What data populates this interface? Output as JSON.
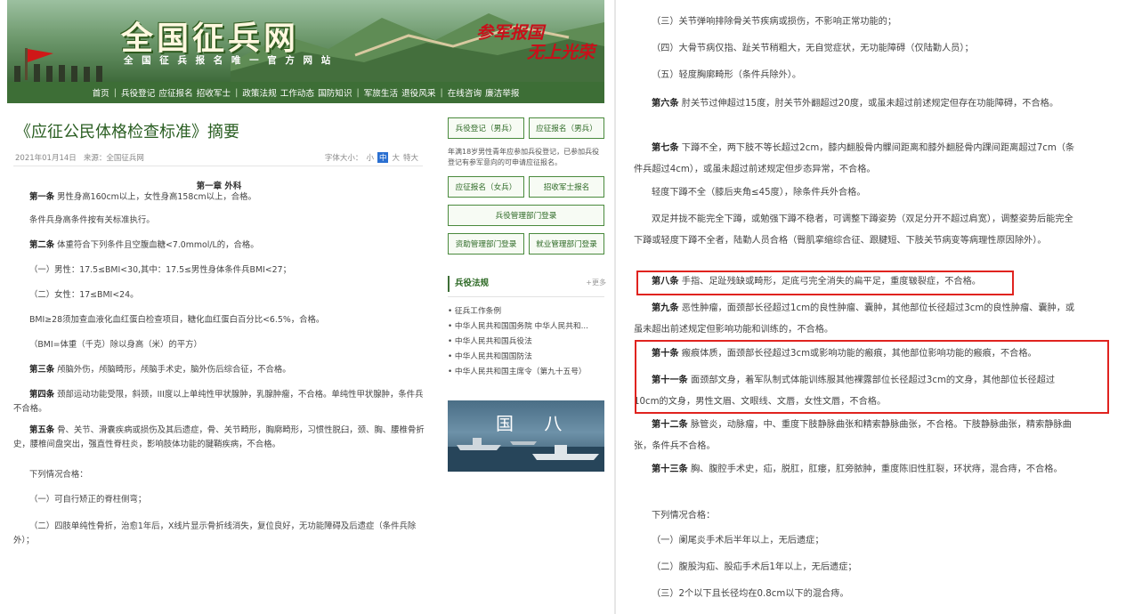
{
  "site": {
    "logo": "全国征兵网",
    "slogan": "全 国 征 兵 报 名 唯 一 官 方 网 站",
    "slogan_main": "参军报国",
    "slogan_sub": "无上光荣"
  },
  "nav": [
    "首页",
    "兵役登记",
    "应征报名",
    "招收军士",
    "政策法规",
    "工作动态",
    "国防知识",
    "军旅生活",
    "退役风采",
    "在线咨询",
    "廉洁举报"
  ],
  "article": {
    "title": "《应征公民体格检查标准》摘要",
    "date": "2021年01月14日",
    "source": "来源：全国征兵网",
    "font_label": "字体大小：",
    "font_small": "小",
    "font_mid": "中",
    "font_large": "大",
    "font_xlarge": "特大",
    "chapter": "第一章 外科",
    "paragraphs": [
      {
        "lead": "第一条",
        "text": " 男性身高160cm以上，女性身高158cm以上，合格。"
      },
      {
        "lead": "",
        "text": "条件兵身高条件按有关标准执行。"
      },
      {
        "lead": "第二条",
        "text": " 体重符合下列条件且空腹血糖<7.0mmol/L的，合格。"
      },
      {
        "lead": "",
        "text": "（一）男性：17.5≤BMI<30,其中：17.5≤男性身体条件兵BMI<27；"
      },
      {
        "lead": "",
        "text": "（二）女性：17≤BMI<24。"
      },
      {
        "lead": "",
        "text": "BMI≥28须加查血液化血红蛋白检查项目，糖化血红蛋白百分比<6.5%，合格。"
      },
      {
        "lead": "",
        "text": "（BMI=体重（千克）除以身高（米）的平方）"
      },
      {
        "lead": "第三条",
        "text": " 颅脑外伤，颅脑畸形，颅脑手术史，脑外伤后综合征，不合格。"
      },
      {
        "lead": "第四条",
        "text": " 颈部运动功能受限，斜颈，III度以上单纯性甲状腺肿，乳腺肿瘤，不合格。单纯性甲状腺肿，条件兵不合格。"
      },
      {
        "lead": "第五条",
        "text": " 骨、关节、滑囊疾病或损伤及其后遗症，骨、关节畸形，胸廓畸形，习惯性脱臼，颈、胸、腰椎骨折史，腰椎间盘突出，强直性脊柱炎，影响肢体功能的腱鞘疾病，不合格。"
      },
      {
        "lead": "",
        "text": "下列情况合格："
      },
      {
        "lead": "",
        "text": "（一）可自行矫正的脊柱侧弯；"
      },
      {
        "lead": "",
        "text": "（二）四肢单纯性骨折，治愈1年后，X线片显示骨折线消失，复位良好，无功能障碍及后遗症（条件兵除外）；"
      }
    ]
  },
  "sidebar": {
    "buttons": [
      "兵役登记（男兵）",
      "应征报名（男兵）",
      "应征报名（女兵）",
      "招收军士报名",
      "兵役管理部门登录",
      "资助管理部门登录",
      "就业管理部门登录"
    ],
    "note": "年满18岁男性青年应参加兵役登记，已参加兵役登记有参军意向的可申请应征报名。",
    "law_title": "兵役法规",
    "law_more": "+更多",
    "laws": [
      "• 征兵工作条例",
      "• 中华人民共和国国务院 中华人民共和...",
      "• 中华人民共和国兵役法",
      "• 中华人民共和国国防法",
      "• 中华人民共和国主席令（第九十五号）"
    ],
    "image_text": "国 八"
  },
  "right": {
    "paragraphs": [
      {
        "lead": "",
        "text": "（三）关节弹响排除骨关节疾病或损伤，不影响正常功能的；"
      },
      {
        "lead": "",
        "text": "（四）大骨节病仅指、趾关节稍粗大，无自觉症状，无功能障碍（仅陆勤人员）；"
      },
      {
        "lead": "",
        "text": "（五）轻度胸廓畸形（条件兵除外）。"
      },
      {
        "lead": "第六条",
        "text": " 肘关节过伸超过15度，肘关节外翻超过20度，或虽未超过前述规定但存在功能障碍，不合格。"
      },
      {
        "lead": "第七条",
        "text": " 下蹲不全，两下肢不等长超过2cm，膝内翻股骨内髁间距离和膝外翻胫骨内踝间距离超过7cm（条件兵超过4cm），或虽未超过前述规定但步态异常，不合格。"
      },
      {
        "lead": "",
        "text": "轻度下蹲不全（膝后夹角≤45度），除条件兵外合格。"
      },
      {
        "lead": "",
        "text": "双足并拢不能完全下蹲，或勉强下蹲不稳者，可调整下蹲姿势（双足分开不超过肩宽），调整姿势后能完全下蹲或轻度下蹲不全者，陆勤人员合格（臀肌挛缩综合征、跟腱短、下肢关节病变等病理性原因除外）。"
      },
      {
        "lead": "第八条",
        "text": " 手指、足趾残缺或畸形，足底弓完全消失的扁平足，重度皲裂症，不合格。"
      },
      {
        "lead": "第九条",
        "text": " 恶性肿瘤，面颈部长径超过1cm的良性肿瘤、囊肿，其他部位长径超过3cm的良性肿瘤、囊肿，或虽未超出前述规定但影响功能和训练的，不合格。"
      },
      {
        "lead": "第十条",
        "text": " 瘢痕体质，面颈部长径超过3cm或影响功能的瘢痕，其他部位影响功能的瘢痕，不合格。"
      },
      {
        "lead": "第十一条",
        "text": " 面颈部文身，着军队制式体能训练服其他裸露部位长径超过3cm的文身，其他部位长径超过10cm的文身，男性文眉、文眼线、文唇，女性文唇，不合格。"
      },
      {
        "lead": "第十二条",
        "text": " 脉管炎，动脉瘤，中、重度下肢静脉曲张和精索静脉曲张，不合格。下肢静脉曲张，精索静脉曲张，条件兵不合格。"
      },
      {
        "lead": "第十三条",
        "text": " 胸、腹腔手术史，疝，脱肛，肛瘘，肛旁脓肿，重度陈旧性肛裂，环状痔，混合痔，不合格。"
      },
      {
        "lead": "",
        "text": "下列情况合格："
      },
      {
        "lead": "",
        "text": "（一）阑尾炎手术后半年以上，无后遗症；"
      },
      {
        "lead": "",
        "text": "（二）腹股沟疝、股疝手术后1年以上，无后遗症；"
      },
      {
        "lead": "",
        "text": "（三）2个以下且长径均在0.8cm以下的混合痔。"
      }
    ]
  },
  "colors": {
    "brand_green": "#3d6e36",
    "highlight_red": "#e0231f"
  }
}
